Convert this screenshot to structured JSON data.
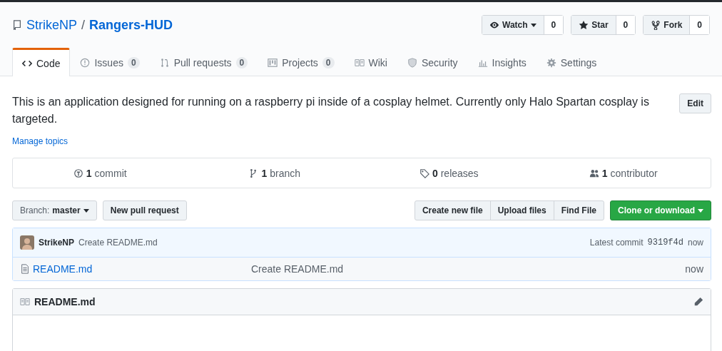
{
  "repo": {
    "owner": "StrikeNP",
    "separator": "/",
    "name": "Rangers-HUD"
  },
  "actions": [
    {
      "kind": "watch",
      "label": "Watch",
      "count": "0"
    },
    {
      "kind": "star",
      "label": "Star",
      "count": "0"
    },
    {
      "kind": "fork",
      "label": "Fork",
      "count": "0"
    }
  ],
  "tabs": [
    {
      "kind": "code",
      "label": "Code",
      "selected": true
    },
    {
      "kind": "issues",
      "label": "Issues",
      "count": "0",
      "selected": false
    },
    {
      "kind": "pulls",
      "label": "Pull requests",
      "count": "0",
      "selected": false
    },
    {
      "kind": "projects",
      "label": "Projects",
      "count": "0",
      "selected": false
    },
    {
      "kind": "wiki",
      "label": "Wiki",
      "selected": false
    },
    {
      "kind": "security",
      "label": "Security",
      "selected": false
    },
    {
      "kind": "insights",
      "label": "Insights",
      "selected": false
    },
    {
      "kind": "settings",
      "label": "Settings",
      "selected": false
    }
  ],
  "description": "This is an application designed for running on a raspberry pi inside of a cosplay helmet. Currently only Halo Spartan cosplay is targeted.",
  "edit_button": "Edit",
  "manage_topics": "Manage topics",
  "summary": [
    {
      "kind": "commit",
      "count": "1",
      "label": "commit"
    },
    {
      "kind": "branch",
      "count": "1",
      "label": "branch"
    },
    {
      "kind": "tag",
      "count": "0",
      "label": "releases"
    },
    {
      "kind": "people",
      "count": "1",
      "label": "contributor"
    }
  ],
  "branch_button": {
    "prefix": "Branch:",
    "value": "master"
  },
  "new_pull_request": "New pull request",
  "file_buttons": [
    "Create new file",
    "Upload files",
    "Find File"
  ],
  "clone_button": "Clone or download",
  "commit": {
    "author": "StrikeNP",
    "message": "Create README.md",
    "prefix": "Latest commit",
    "sha": "9319f4d",
    "time": "now"
  },
  "files": [
    {
      "name": "README.md",
      "message": "Create README.md",
      "time": "now"
    }
  ],
  "readme": {
    "title": "README.md"
  }
}
